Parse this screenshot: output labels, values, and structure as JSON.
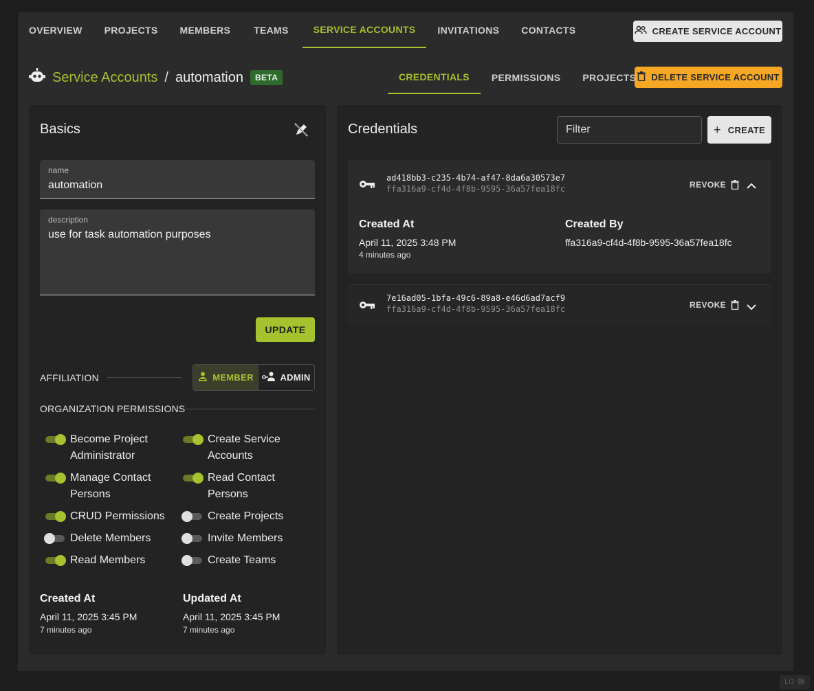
{
  "top_nav": {
    "tabs": [
      {
        "label": "OVERVIEW"
      },
      {
        "label": "PROJECTS"
      },
      {
        "label": "MEMBERS"
      },
      {
        "label": "TEAMS"
      },
      {
        "label": "SERVICE ACCOUNTS",
        "active": true
      },
      {
        "label": "INVITATIONS"
      },
      {
        "label": "CONTACTS"
      }
    ],
    "create_button": "CREATE SERVICE ACCOUNT"
  },
  "header": {
    "breadcrumb_link": "Service Accounts",
    "separator": "/",
    "current": "automation",
    "badge": "BETA",
    "sub_tabs": [
      {
        "label": "CREDENTIALS",
        "active": true
      },
      {
        "label": "PERMISSIONS"
      },
      {
        "label": "PROJECTS"
      }
    ],
    "delete_button": "DELETE SERVICE ACCOUNT"
  },
  "basics": {
    "title": "Basics",
    "name_label": "name",
    "name_value": "automation",
    "description_label": "description",
    "description_value": "use for task automation purposes",
    "update_button": "UPDATE",
    "affiliation_label": "AFFILIATION",
    "affiliation_options": [
      "MEMBER",
      "ADMIN"
    ],
    "affiliation_selected": "MEMBER",
    "org_permissions_label": "ORGANIZATION PERMISSIONS",
    "permissions": [
      {
        "label": "Become Project Administrator",
        "enabled": true
      },
      {
        "label": "Create Service Accounts",
        "enabled": true
      },
      {
        "label": "Manage Contact Persons",
        "enabled": true
      },
      {
        "label": "Read Contact Persons",
        "enabled": true
      },
      {
        "label": "CRUD Permissions",
        "enabled": true
      },
      {
        "label": "Create Projects",
        "enabled": false
      },
      {
        "label": "Delete Members",
        "enabled": false
      },
      {
        "label": "Invite Members",
        "enabled": false
      },
      {
        "label": "Read Members",
        "enabled": true
      },
      {
        "label": "Create Teams",
        "enabled": false
      }
    ],
    "created_at_label": "Created At",
    "created_at": "April 11, 2025 3:45 PM",
    "created_at_relative": "7 minutes ago",
    "updated_at_label": "Updated At",
    "updated_at": "April 11, 2025 3:45 PM",
    "updated_at_relative": "7 minutes ago"
  },
  "credentials": {
    "title": "Credentials",
    "filter_placeholder": "Filter",
    "create_button": "CREATE",
    "items": [
      {
        "id": "ad418bb3-c235-4b74-af47-8da6a30573e7",
        "owner": "ffa316a9-cf4d-4f8b-9595-36a57fea18fc",
        "revoke_label": "REVOKE",
        "expanded": true,
        "created_at_label": "Created At",
        "created_at": "April 11, 2025 3:48 PM",
        "created_at_relative": "4 minutes ago",
        "created_by_label": "Created By",
        "created_by": "ffa316a9-cf4d-4f8b-9595-36a57fea18fc"
      },
      {
        "id": "7e16ad05-1bfa-49c6-89a8-e46d6ad7acf9",
        "owner": "ffa316a9-cf4d-4f8b-9595-36a57fea18fc",
        "revoke_label": "REVOKE",
        "expanded": false
      }
    ]
  },
  "watermark": "LG",
  "colors": {
    "accent": "#a6c22e",
    "warning": "#f5a623",
    "badge": "#2e6a2e",
    "background": "#1e1e1e",
    "surface": "#2b2b2b"
  },
  "icons": [
    "robot-icon",
    "users-icon",
    "trash-icon",
    "edit-off-icon",
    "plus-icon",
    "key-icon",
    "chevron-up-icon",
    "chevron-down-icon",
    "member-icon",
    "admin-icon",
    "gear-icon"
  ]
}
